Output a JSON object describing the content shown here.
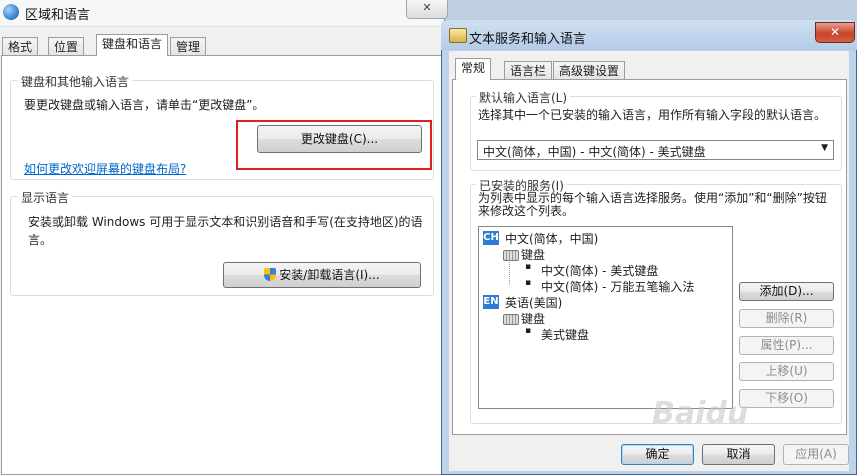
{
  "left_window": {
    "title": "区域和语言",
    "close_label": "✕",
    "tabs": [
      "格式",
      "位置",
      "键盘和语言",
      "管理"
    ],
    "keyboard_group": {
      "legend": "键盘和其他输入语言",
      "instruction": "要更改键盘或输入语言，请单击“更改键盘”。",
      "change_keyboard_button": "更改键盘(C)...",
      "link": "如何更改欢迎屏幕的键盘布局?"
    },
    "display_group": {
      "legend": "显示语言",
      "description": "安装或卸载 Windows 可用于显示文本和识别语音和手写(在支持地区)的语言。",
      "install_button": "安装/卸载语言(I)..."
    },
    "highlight_color": "#e02020"
  },
  "right_window": {
    "title": "文本服务和输入语言",
    "close_label": "✕",
    "tabs": [
      "常规",
      "语言栏",
      "高级键设置"
    ],
    "default_group": {
      "legend": "默认输入语言(L)",
      "description": "选择其中一个已安装的输入语言，用作所有输入字段的默认语言。",
      "selected": "中文(简体，中国) - 中文(简体) - 美式键盘"
    },
    "services_group": {
      "legend": "已安装的服务(I)",
      "description": "为列表中显示的每个输入语言选择服务。使用“添加”和“删除”按钮来修改这个列表。",
      "tree": {
        "lang1": {
          "badge": "CH",
          "name": "中文(简体，中国)",
          "category": "键盘",
          "items": [
            "中文(简体) - 美式键盘",
            "中文(简体) - 万能五笔输入法"
          ]
        },
        "lang2": {
          "badge": "EN",
          "name": "英语(美国)",
          "category": "键盘",
          "items": [
            "美式键盘"
          ]
        }
      },
      "buttons": {
        "add": "添加(D)...",
        "remove": "删除(R)",
        "properties": "属性(P)...",
        "move_up": "上移(U)",
        "move_down": "下移(O)"
      }
    },
    "footer": {
      "ok": "确定",
      "cancel": "取消",
      "apply": "应用(A)"
    },
    "watermark": "Baidu"
  }
}
